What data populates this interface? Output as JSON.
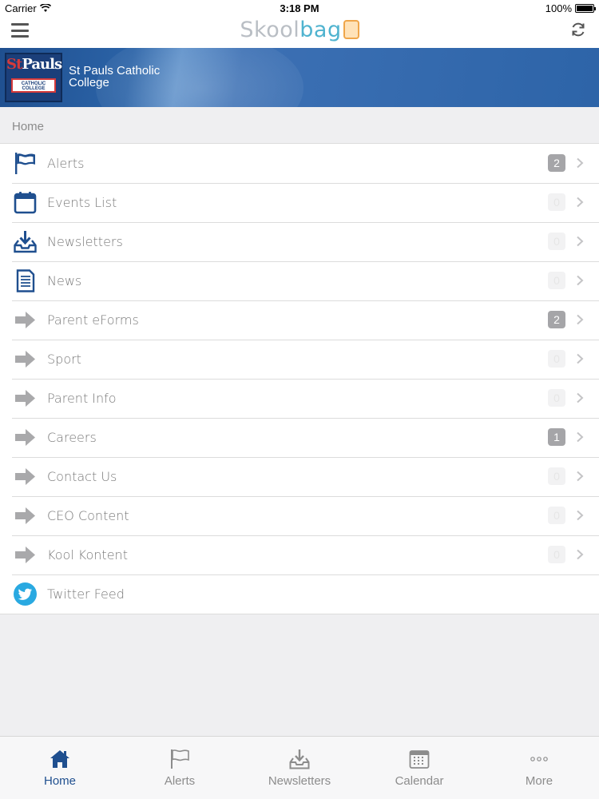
{
  "status_bar": {
    "carrier": "Carrier",
    "time": "3:18 PM",
    "battery": "100%"
  },
  "app_header": {
    "logo_part1": "Skool",
    "logo_part2": "bag"
  },
  "school": {
    "name": "St Pauls Catholic College",
    "crest_text_1": "S",
    "crest_text_2": "t",
    "crest_text_3": "Pauls",
    "crest_sub": "CATHOLIC COLLEGE"
  },
  "breadcrumb": "Home",
  "menu": [
    {
      "label": "Alerts",
      "icon": "flag-icon",
      "badge": "2",
      "badge_zero": false
    },
    {
      "label": "Events List",
      "icon": "calendar-icon",
      "badge": "0",
      "badge_zero": true
    },
    {
      "label": "Newsletters",
      "icon": "download-inbox-icon",
      "badge": "0",
      "badge_zero": true
    },
    {
      "label": "News",
      "icon": "document-icon",
      "badge": "0",
      "badge_zero": true
    },
    {
      "label": "Parent eForms",
      "icon": "arrow-right-icon",
      "badge": "2",
      "badge_zero": false
    },
    {
      "label": "Sport",
      "icon": "arrow-right-icon",
      "badge": "0",
      "badge_zero": true
    },
    {
      "label": "Parent Info",
      "icon": "arrow-right-icon",
      "badge": "0",
      "badge_zero": true
    },
    {
      "label": "Careers",
      "icon": "arrow-right-icon",
      "badge": "1",
      "badge_zero": false
    },
    {
      "label": "Contact Us",
      "icon": "arrow-right-icon",
      "badge": "0",
      "badge_zero": true
    },
    {
      "label": "CEO Content",
      "icon": "arrow-right-icon",
      "badge": "0",
      "badge_zero": true
    },
    {
      "label": "Kool Kontent",
      "icon": "arrow-right-icon",
      "badge": "0",
      "badge_zero": true
    },
    {
      "label": "Twitter Feed",
      "icon": "twitter-icon",
      "badge": "",
      "badge_zero": true
    }
  ],
  "tabs": [
    {
      "label": "Home",
      "icon": "home-icon",
      "active": true
    },
    {
      "label": "Alerts",
      "icon": "flag-icon",
      "active": false
    },
    {
      "label": "Newsletters",
      "icon": "download-inbox-icon",
      "active": false
    },
    {
      "label": "Calendar",
      "icon": "calendar-icon",
      "active": false
    },
    {
      "label": "More",
      "icon": "more-dots-icon",
      "active": false
    }
  ],
  "colors": {
    "brand_blue": "#1f4f8f",
    "badge_gray": "#a5a5a8",
    "twitter_blue": "#29a9e1"
  }
}
